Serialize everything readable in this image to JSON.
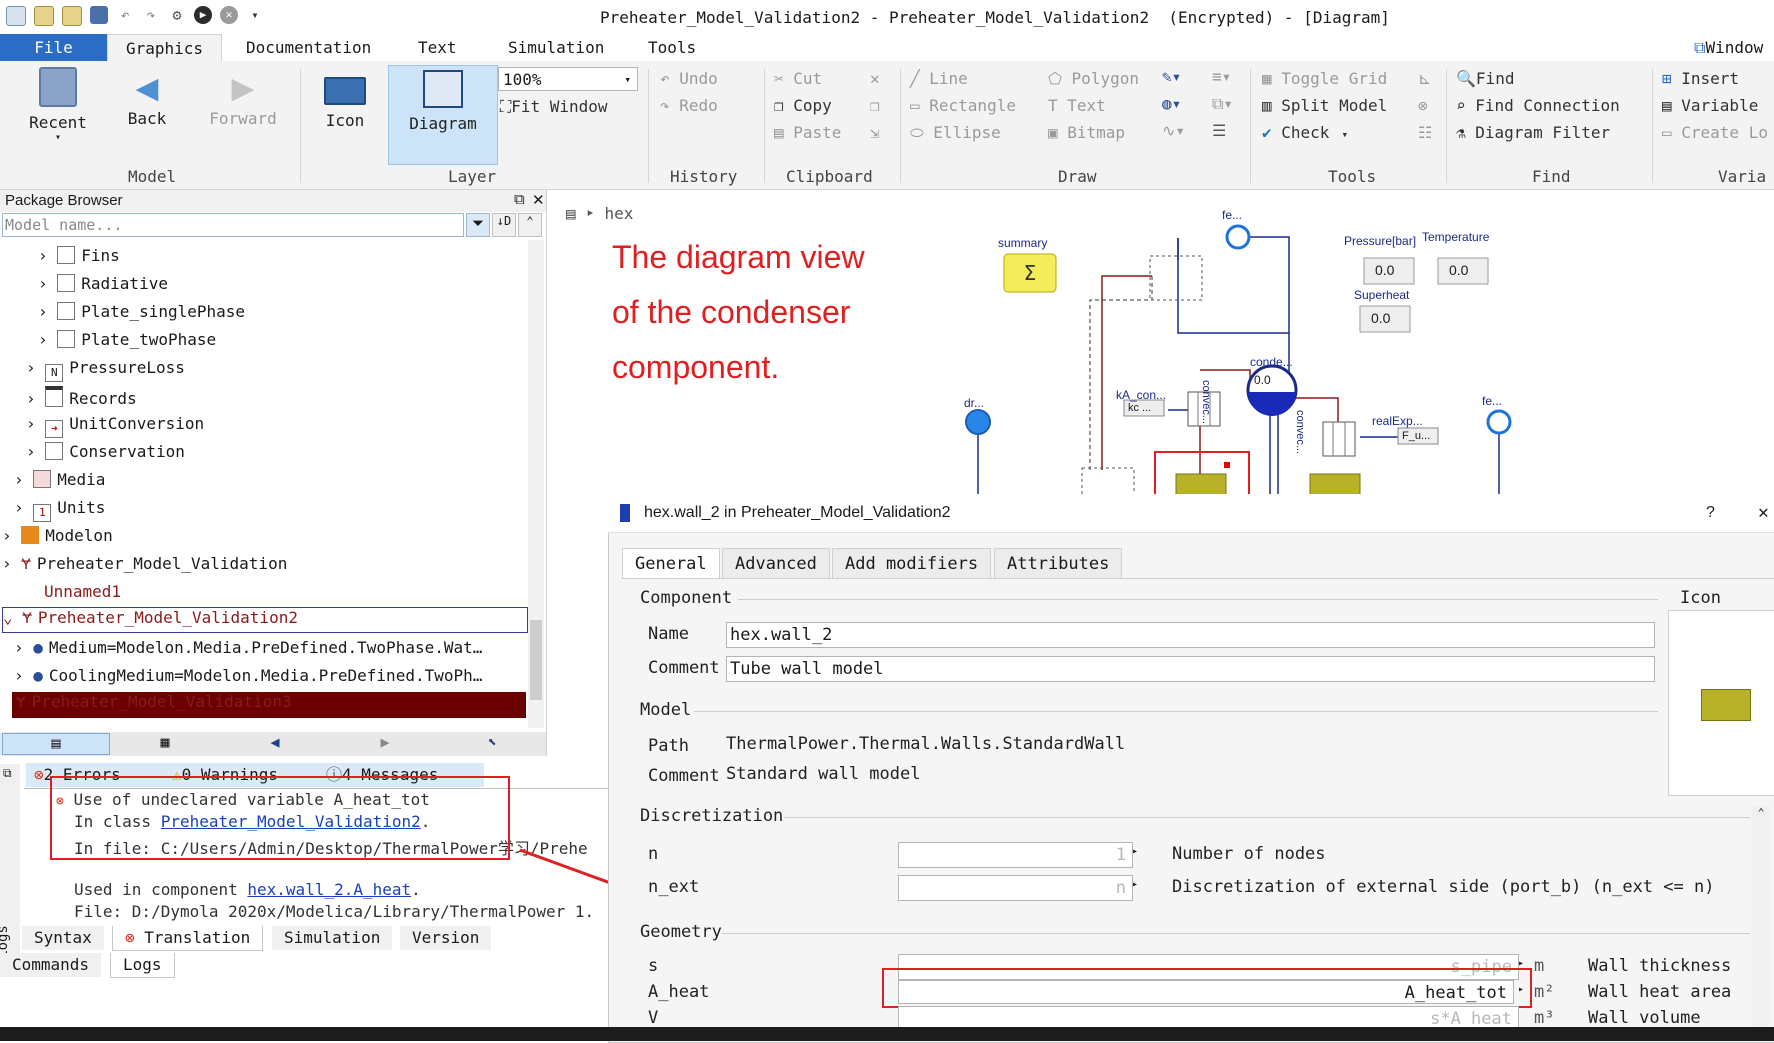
{
  "window": {
    "title": "Preheater_Model_Validation2 - Preheater_Model_Validation2  (Encrypted) - [Diagram]"
  },
  "menu_tabs": {
    "file": "File",
    "graphics": "Graphics",
    "documentation": "Documentation",
    "text": "Text",
    "simulation": "Simulation",
    "tools": "Tools",
    "window": "Window"
  },
  "ribbon": {
    "model": {
      "recent": "Recent",
      "back": "Back",
      "forward": "Forward",
      "group": "Model"
    },
    "layer": {
      "icon": "Icon",
      "diagram": "Diagram",
      "zoom": "100%",
      "fit": "Fit Window",
      "group": "Layer"
    },
    "history": {
      "undo": "Undo",
      "redo": "Redo",
      "group": "History"
    },
    "clipboard": {
      "cut": "Cut",
      "copy": "Copy",
      "paste": "Paste",
      "group": "Clipboard"
    },
    "draw": {
      "line": "Line",
      "rectangle": "Rectangle",
      "ellipse": "Ellipse",
      "polygon": "Polygon",
      "text": "Text",
      "bitmap": "Bitmap",
      "group": "Draw"
    },
    "tools": {
      "toggle_grid": "Toggle Grid",
      "split_model": "Split Model",
      "check": "Check",
      "group": "Tools"
    },
    "find": {
      "find": "Find",
      "find_connection": "Find Connection",
      "diagram_filter": "Diagram Filter",
      "group": "Find"
    },
    "variables": {
      "insert": "Insert",
      "variable": "Variable",
      "create_local": "Create Lo",
      "group": "Varia"
    }
  },
  "package_browser": {
    "title": "Package Browser",
    "search_placeholder": "Model name...",
    "items": [
      {
        "label": "Fins"
      },
      {
        "label": "Radiative"
      },
      {
        "label": "Plate_singlePhase"
      },
      {
        "label": "Plate_twoPhase"
      },
      {
        "label": "PressureLoss"
      },
      {
        "label": "Records"
      },
      {
        "label": "UnitConversion"
      },
      {
        "label": "Conservation"
      },
      {
        "label": "Media"
      },
      {
        "label": "Units"
      },
      {
        "label": "Modelon"
      },
      {
        "label": "Preheater_Model_Validation"
      },
      {
        "label": "Unnamed1"
      },
      {
        "label": "Preheater_Model_Validation2"
      },
      {
        "label": "Medium=Modelon.Media.PreDefined.TwoPhase.Wat…"
      },
      {
        "label": "CoolingMedium=Modelon.Media.PreDefined.TwoPh…"
      },
      {
        "label": "Preheater_Model_Validation3"
      }
    ]
  },
  "messages": {
    "tabs": {
      "errors": "2 Errors",
      "warnings": "0 Warnings",
      "messages": "4 Messages"
    },
    "lines": {
      "l1": "Use of undeclared variable A_heat_tot",
      "l2_prefix": "In class ",
      "l2_link": "Preheater_Model_Validation2",
      "l2_suffix": ".",
      "l3": "In file: C:/Users/Admin/Desktop/ThermalPower学习/Prehe",
      "l4_prefix": "Used in component ",
      "l4_link": "hex.wall_2.A_heat",
      "l4_suffix": ".",
      "l5": "File: D:/Dymola 2020x/Modelica/Library/ThermalPower 1."
    },
    "bottom_tabs": {
      "syntax": "Syntax",
      "translation": "Translation",
      "simulation": "Simulation",
      "version": "Version",
      "commands": "Commands",
      "logs": "Logs"
    },
    "side_label": "Logs"
  },
  "diagram": {
    "breadcrumb": "hex",
    "note_lines": [
      "The diagram view",
      "of the condenser",
      "component."
    ],
    "labels": {
      "summary": "summary",
      "fe_top": "fe...",
      "fe_right": "fe...",
      "dr": "dr...",
      "pressure": "Pressure[bar]",
      "temperature": "Temperature",
      "superheat": "Superheat",
      "p_val": "0.0",
      "t_val": "0.0",
      "s_val": "0.0",
      "conde": "conde...",
      "conde_val": "0.0",
      "ka_con": "kA_con...",
      "kc": "kc ...",
      "convec1": "convec...",
      "convec2": "convec...",
      "realexp": "realExp...",
      "fu": "F_u..."
    }
  },
  "dialog": {
    "title": "hex.wall_2 in Preheater_Model_Validation2",
    "help": "?",
    "tabs": {
      "general": "General",
      "advanced": "Advanced",
      "add_modifiers": "Add modifiers",
      "attributes": "Attributes"
    },
    "component_section": "Component",
    "icon_section": "Icon",
    "name_label": "Name",
    "name_value": "hex.wall_2",
    "comment_label": "Comment",
    "comment_value": "Tube wall model",
    "model_section": "Model",
    "path_label": "Path",
    "path_value": "ThermalPower.Thermal.Walls.StandardWall",
    "model_comment_label": "Comment",
    "model_comment_value": "Standard wall model",
    "discretization_section": "Discretization",
    "params": [
      {
        "name": "n",
        "placeholder": "1",
        "desc": "Number of nodes"
      },
      {
        "name": "n_ext",
        "placeholder": "n",
        "desc": "Discretization of external side (port_b) (n_ext <= n)"
      }
    ],
    "geometry_section": "Geometry",
    "geometry": [
      {
        "name": "s",
        "placeholder": "s_pipe",
        "unit": "m",
        "desc": "Wall thickness"
      },
      {
        "name": "A_heat",
        "value": "A_heat_tot",
        "unit": "m²",
        "desc": "Wall heat area"
      },
      {
        "name": "V",
        "placeholder": "s*A_heat",
        "unit": "m³",
        "desc": "Wall volume"
      }
    ]
  },
  "colors": {
    "accent": "#2b6cc4",
    "annotation_red": "#e02020",
    "selected_row": "#6b0000"
  }
}
